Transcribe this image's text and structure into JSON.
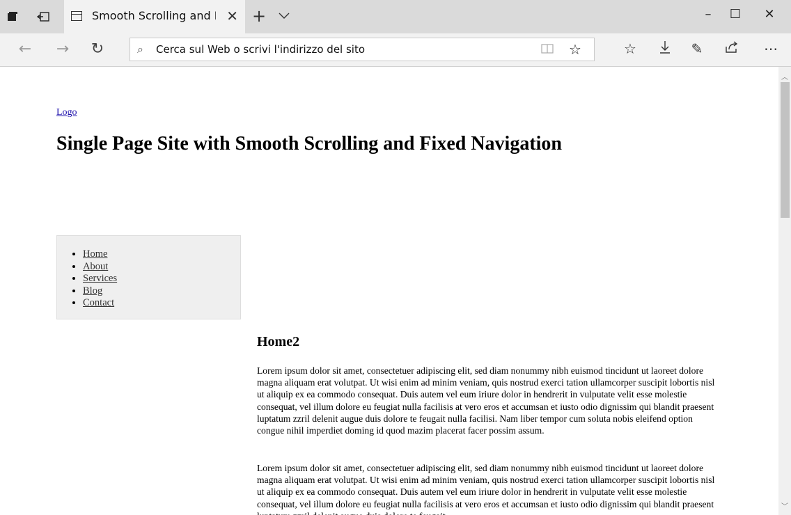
{
  "browser": {
    "tab_title": "Smooth Scrolling and Fi",
    "address_placeholder": "Cerca sul Web o scrivi l'indirizzo del sito"
  },
  "page": {
    "logo": "Logo",
    "heading": "Single Page Site with Smooth Scrolling and Fixed Navigation",
    "nav": [
      {
        "label": "Home"
      },
      {
        "label": "About"
      },
      {
        "label": "Services"
      },
      {
        "label": "Blog"
      },
      {
        "label": "Contact"
      }
    ],
    "section_title": "Home2",
    "paragraph1": "Lorem ipsum dolor sit amet, consectetuer adipiscing elit, sed diam nonummy nibh euismod tincidunt ut laoreet dolore magna aliquam erat volutpat. Ut wisi enim ad minim veniam, quis nostrud exerci tation ullamcorper suscipit lobortis nisl ut aliquip ex ea commodo consequat. Duis autem vel eum iriure dolor in hendrerit in vulputate velit esse molestie consequat, vel illum dolore eu feugiat nulla facilisis at vero eros et accumsan et iusto odio dignissim qui blandit praesent luptatum zzril delenit augue duis dolore te feugait nulla facilisi. Nam liber tempor cum soluta nobis eleifend option congue nihil imperdiet doming id quod mazim placerat facer possim assum.",
    "paragraph2": "Lorem ipsum dolor sit amet, consectetuer adipiscing elit, sed diam nonummy nibh euismod tincidunt ut laoreet dolore magna aliquam erat volutpat. Ut wisi enim ad minim veniam, quis nostrud exerci tation ullamcorper suscipit lobortis nisl ut aliquip ex ea commodo consequat. Duis autem vel eum iriure dolor in hendrerit in vulputate velit esse molestie consequat, vel illum dolore eu feugiat nulla facilisis at vero eros et accumsan et iusto odio dignissim qui blandit praesent luptatum zzril delenit augue duis dolore te feugait"
  },
  "icons": {
    "tab_actions": "window-icon",
    "set_aside": "set-aside-tabs-icon",
    "favicon": "page-icon",
    "close": "close-icon",
    "new_tab": "plus-icon",
    "tab_list": "chevron-down-icon",
    "back": "back-arrow-icon",
    "forward": "forward-arrow-icon",
    "refresh": "refresh-icon",
    "search": "search-icon",
    "reading_view": "book-icon",
    "favorite": "star-icon",
    "favorites_hub": "favorites-list-icon",
    "downloads": "download-icon",
    "web_note": "pen-icon",
    "share": "share-icon",
    "more": "more-icon"
  }
}
